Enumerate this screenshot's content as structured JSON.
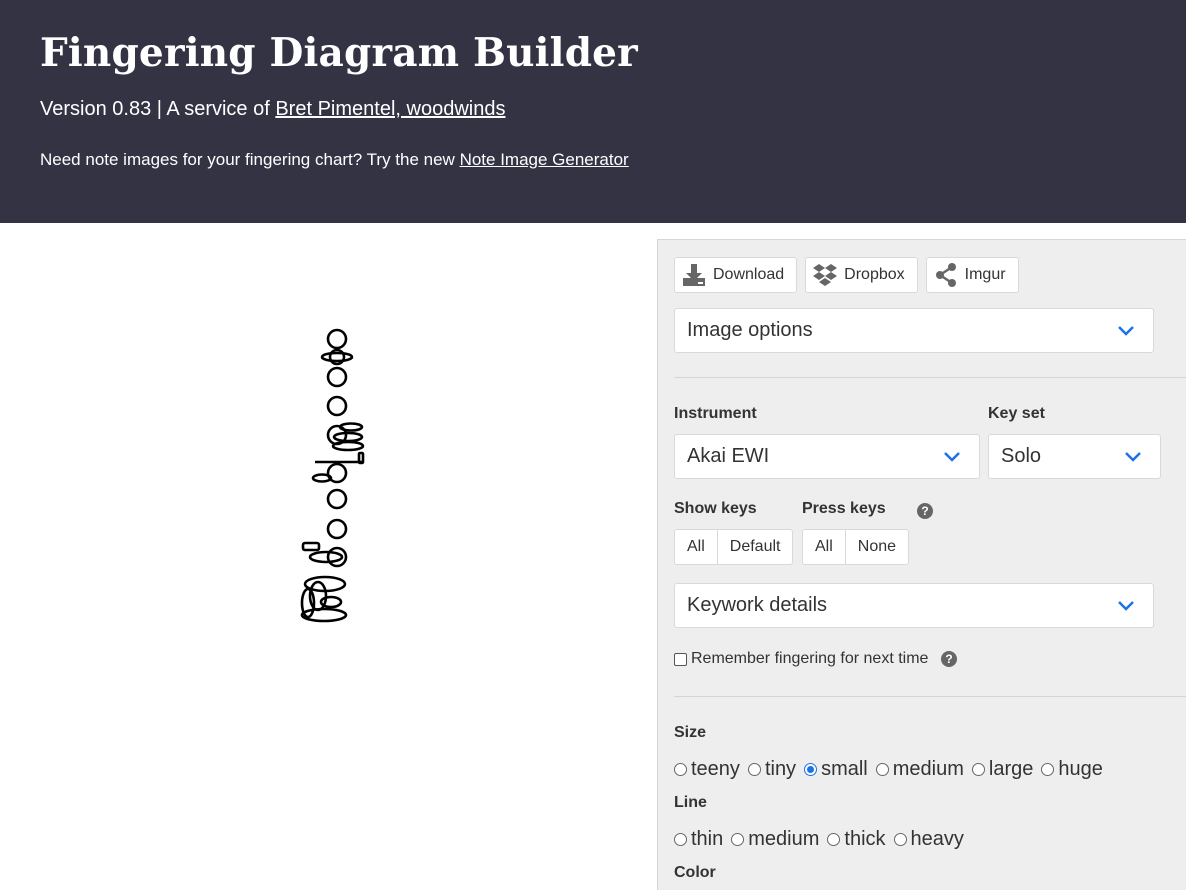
{
  "header": {
    "title": "Fingering Diagram Builder",
    "version_text": "Version 0.83 | A service of ",
    "author_link": "Bret Pimentel, woodwinds",
    "promo_text": "Need note images for your fingering chart? Try the new ",
    "promo_link": "Note Image Generator"
  },
  "toolbar": {
    "download_label": "Download",
    "dropbox_label": "Dropbox",
    "imgur_label": "Imgur"
  },
  "image_options": {
    "label": "Image options"
  },
  "instrument": {
    "label": "Instrument",
    "value": "Akai EWI"
  },
  "keyset": {
    "label": "Key set",
    "value": "Solo"
  },
  "show_keys": {
    "label": "Show keys",
    "options": [
      "All",
      "Default"
    ]
  },
  "press_keys": {
    "label": "Press keys",
    "options": [
      "All",
      "None"
    ]
  },
  "keywork": {
    "label": "Keywork details"
  },
  "remember": {
    "label": "Remember fingering for next time"
  },
  "size": {
    "label": "Size",
    "options": [
      "teeny",
      "tiny",
      "small",
      "medium",
      "large",
      "huge"
    ],
    "selected": "small"
  },
  "line": {
    "label": "Line",
    "options": [
      "thin",
      "medium",
      "thick",
      "heavy"
    ]
  },
  "color": {
    "label": "Color"
  },
  "colors": {
    "header_bg": "#333344",
    "panel_bg": "#eeeeee",
    "accent": "#1a73e8"
  }
}
